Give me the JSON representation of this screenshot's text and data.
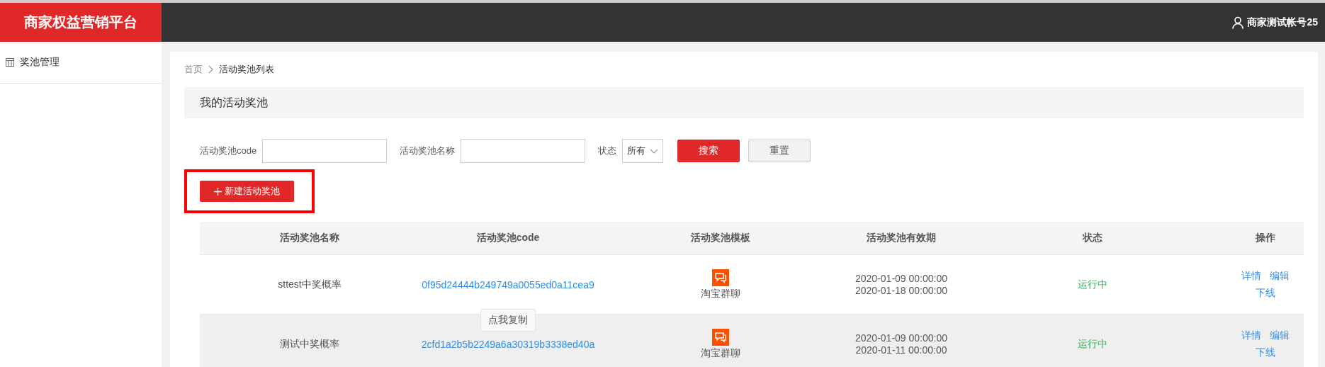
{
  "header": {
    "brand": "商家权益营销平台",
    "user": "商家测试帐号25"
  },
  "sidebar": {
    "items": [
      {
        "label": "奖池管理"
      }
    ]
  },
  "breadcrumb": [
    "首页",
    "活动奖池列表"
  ],
  "panel": {
    "title": "我的活动奖池"
  },
  "filters": {
    "code_label": "活动奖池code",
    "name_label": "活动奖池名称",
    "status_label": "状态",
    "status_value": "所有",
    "search_button": "搜索",
    "reset_button": "重置"
  },
  "new_button": {
    "label": "新建活动奖池",
    "highlighted": true
  },
  "table": {
    "columns": [
      "活动奖池名称",
      "活动奖池code",
      "活动奖池模板",
      "活动奖池有效期",
      "状态",
      "操作"
    ],
    "rows": [
      {
        "name": "sttest中奖概率",
        "code": "0f95d24444b249749a0055ed0a11cea9",
        "template": "淘宝群聊",
        "start": "2020-01-09 00:00:00",
        "end": "2020-01-18 00:00:00",
        "status": "运行中",
        "actions": [
          "详情",
          "编辑",
          "下线"
        ],
        "hovered": false
      },
      {
        "name": "测试中奖概率",
        "code": "2cfd1a2b5b2249a6a30319b3338ed40a",
        "template": "淘宝群聊",
        "start": "2020-01-09 00:00:00",
        "end": "2020-01-11 00:00:00",
        "status": "运行中",
        "actions": [
          "详情",
          "编辑",
          "下线"
        ],
        "hovered": true,
        "tooltip": "点我复制"
      }
    ]
  }
}
